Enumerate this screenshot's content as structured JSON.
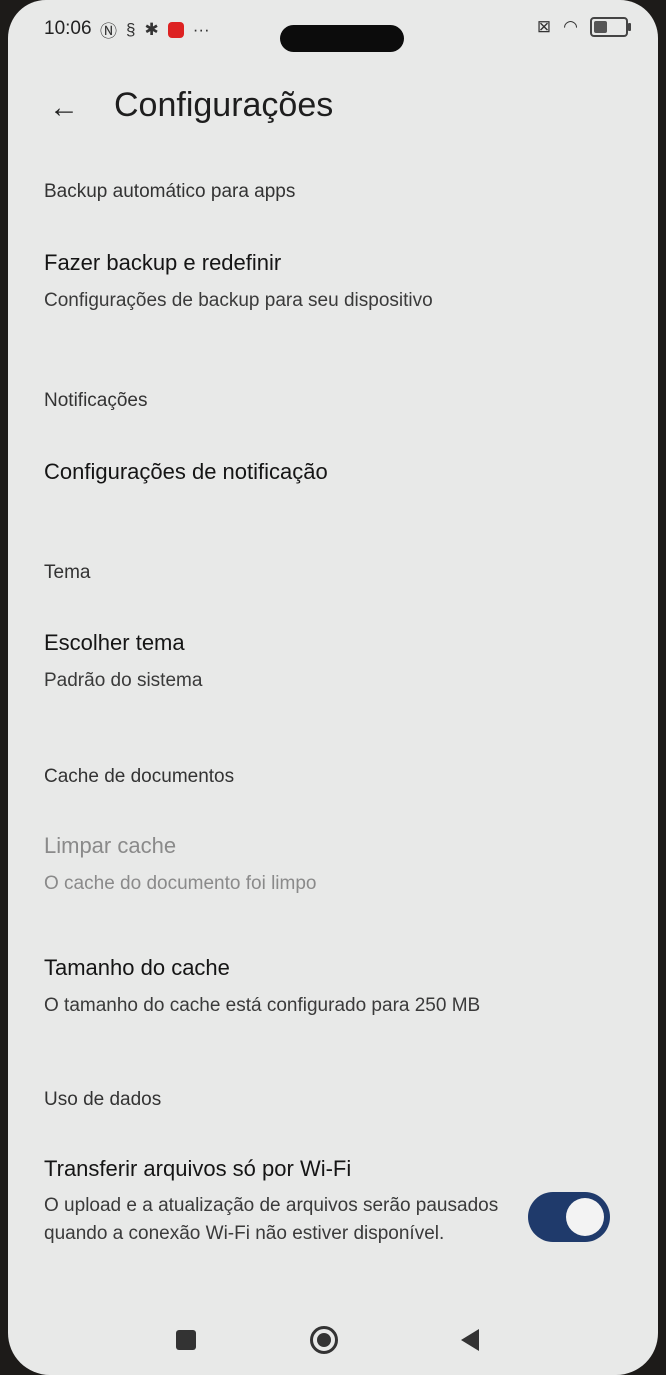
{
  "status_bar": {
    "time": "10:06",
    "icons": [
      "nfc-icon",
      "sync-icon",
      "gear-icon",
      "app-notification-icon",
      "more-icon"
    ],
    "right_icons": [
      "screen-icon",
      "wifi-icon",
      "battery-icon"
    ]
  },
  "app_bar": {
    "title": "Configurações"
  },
  "sections": {
    "backup": {
      "header": "Backup automático para apps",
      "item_title": "Fazer backup e redefinir",
      "item_subtitle": "Configurações de backup para seu dispositivo"
    },
    "notifications": {
      "header": "Notificações",
      "item_title": "Configurações de notificação"
    },
    "theme": {
      "header": "Tema",
      "item_title": "Escolher tema",
      "item_subtitle": "Padrão do sistema"
    },
    "cache": {
      "header": "Cache de documentos",
      "clear_title": "Limpar cache",
      "clear_subtitle": "O cache do documento foi limpo",
      "size_title": "Tamanho do cache",
      "size_subtitle": "O tamanho do cache está configurado para 250 MB"
    },
    "data_usage": {
      "header": "Uso de dados",
      "item_title": "Transferir arquivos só por Wi-Fi",
      "item_subtitle": "O upload e a atualização de arquivos serão pausados quando a conexão Wi-Fi não estiver disponível.",
      "toggle_on": true
    }
  },
  "nav_bar": {
    "buttons": [
      "recents-icon",
      "home-icon",
      "back-icon"
    ]
  },
  "colors": {
    "toggle_on": "#1f3a6b",
    "background": "#e8e9e8"
  }
}
